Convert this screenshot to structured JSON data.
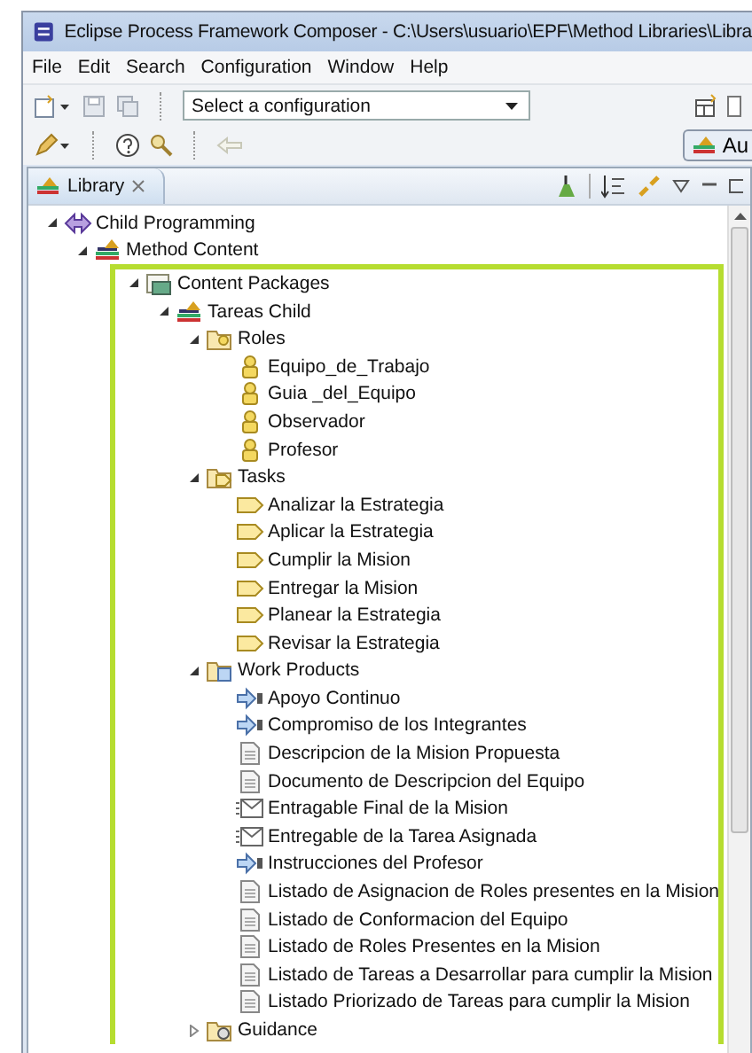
{
  "window": {
    "title": "Eclipse Process Framework Composer - C:\\Users\\usuario\\EPF\\Method Libraries\\Libra"
  },
  "menu": [
    "File",
    "Edit",
    "Search",
    "Configuration",
    "Window",
    "Help"
  ],
  "toolbar": {
    "configuration": "Select a configuration",
    "perspective": "Au"
  },
  "view": {
    "title": "Library"
  },
  "tree": [
    {
      "label": "Child Programming",
      "kind": "plugin",
      "expanded": true,
      "children": [
        {
          "label": "Method Content",
          "kind": "library",
          "expanded": true,
          "children": [
            {
              "label": "Content Packages",
              "kind": "packages",
              "expanded": true,
              "highlighted": true,
              "children": [
                {
                  "label": "Tareas Child",
                  "kind": "library",
                  "expanded": true,
                  "children": [
                    {
                      "label": "Roles",
                      "kind": "roles-folder",
                      "expanded": true,
                      "children": [
                        {
                          "label": "Equipo_de_Trabajo",
                          "kind": "role"
                        },
                        {
                          "label": "Guia _del_Equipo",
                          "kind": "role"
                        },
                        {
                          "label": "Observador",
                          "kind": "role"
                        },
                        {
                          "label": "Profesor",
                          "kind": "role"
                        }
                      ]
                    },
                    {
                      "label": "Tasks",
                      "kind": "tasks-folder",
                      "expanded": true,
                      "children": [
                        {
                          "label": "Analizar la Estrategia",
                          "kind": "task"
                        },
                        {
                          "label": "Aplicar la Estrategia",
                          "kind": "task"
                        },
                        {
                          "label": "Cumplir la Mision",
                          "kind": "task"
                        },
                        {
                          "label": "Entregar la Mision",
                          "kind": "task"
                        },
                        {
                          "label": "Planear la Estrategia",
                          "kind": "task"
                        },
                        {
                          "label": "Revisar la Estrategia",
                          "kind": "task"
                        }
                      ]
                    },
                    {
                      "label": "Work Products",
                      "kind": "products-folder",
                      "expanded": true,
                      "children": [
                        {
                          "label": "Apoyo Continuo",
                          "kind": "outcome"
                        },
                        {
                          "label": "Compromiso de los Integrantes",
                          "kind": "outcome"
                        },
                        {
                          "label": "Descripcion de la Mision Propuesta",
                          "kind": "artifact"
                        },
                        {
                          "label": "Documento de Descripcion del Equipo",
                          "kind": "artifact"
                        },
                        {
                          "label": "Entragable Final de la Mision",
                          "kind": "deliverable"
                        },
                        {
                          "label": "Entregable de la Tarea Asignada",
                          "kind": "deliverable"
                        },
                        {
                          "label": "Instrucciones del Profesor",
                          "kind": "outcome"
                        },
                        {
                          "label": "Listado de Asignacion de Roles presentes en la Mision",
                          "kind": "artifact"
                        },
                        {
                          "label": "Listado de Conformacion del Equipo",
                          "kind": "artifact"
                        },
                        {
                          "label": "Listado de Roles Presentes en la Mision",
                          "kind": "artifact"
                        },
                        {
                          "label": "Listado de Tareas a Desarrollar para cumplir la Mision",
                          "kind": "artifact"
                        },
                        {
                          "label": "Listado Priorizado de Tareas para cumplir la Mision",
                          "kind": "artifact"
                        }
                      ]
                    },
                    {
                      "label": "Guidance",
                      "kind": "guidance-folder",
                      "expanded": false
                    }
                  ]
                }
              ]
            }
          ]
        }
      ]
    }
  ]
}
